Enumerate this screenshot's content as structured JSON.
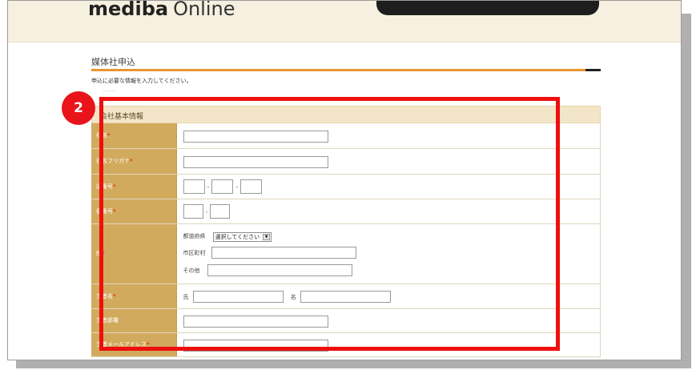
{
  "header": {
    "logo_bold": "mediba",
    "logo_light": "Online"
  },
  "page": {
    "title": "媒体社申込",
    "subtitle": "申込に必要な情報を入力してください。"
  },
  "section": {
    "title": "会社基本情報"
  },
  "fields": [
    {
      "label": "社名",
      "required": true
    },
    {
      "label": "社名フリガナ",
      "required": true
    },
    {
      "label": "話番号",
      "required": true
    },
    {
      "label": "便番号",
      "required": true
    },
    {
      "label": "所",
      "required": true
    },
    {
      "label": "当者名",
      "required": true
    },
    {
      "label": "当者部署",
      "required": false
    },
    {
      "label": "当者メールアドレス",
      "required": true
    }
  ],
  "address": {
    "prefecture_label": "都道府県",
    "prefecture_select": "選択してください",
    "city_label": "市区町村",
    "other_label": "その他"
  },
  "name": {
    "last_label": "氏",
    "first_label": "名"
  },
  "separators": {
    "dash": "-"
  },
  "annotation": {
    "step_number": "2",
    "highlight_color": "#ee0f0f",
    "badge_color": "#e8141a"
  },
  "colors": {
    "label_bg": "#d2aa5d",
    "header_bg": "#f7efdf",
    "accent_line": "#e89530"
  },
  "icons": {
    "select_arrow": "chevron-down-icon"
  }
}
